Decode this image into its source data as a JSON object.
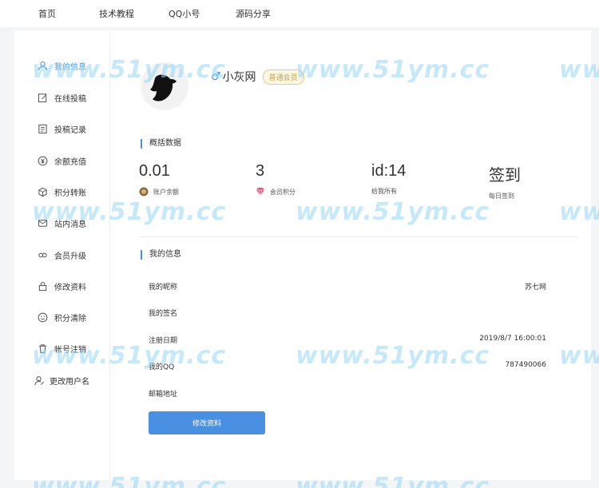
{
  "topnav": {
    "items": [
      "首页",
      "技术教程",
      "QQ小号",
      "源码分享"
    ]
  },
  "sidebar": {
    "items": [
      {
        "label": "我的信息",
        "icon": "user-icon",
        "active": true
      },
      {
        "label": "在线投稿",
        "icon": "edit-icon"
      },
      {
        "label": "投稿记录",
        "icon": "document-icon"
      },
      {
        "label": "余额充值",
        "icon": "yen-icon"
      },
      {
        "label": "积分转账",
        "icon": "cube-icon"
      },
      {
        "label": "站内消息",
        "icon": "message-icon"
      },
      {
        "label": "会员升级",
        "icon": "vip-icon"
      },
      {
        "label": "修改资料",
        "icon": "lock-icon"
      },
      {
        "label": "积分清除",
        "icon": "smile-icon"
      },
      {
        "label": "帐号注销",
        "icon": "trash-icon"
      },
      {
        "label": "更改用户名",
        "icon": "user-edit-icon"
      }
    ]
  },
  "profile": {
    "gender_symbol": "♂",
    "username": "小灰网",
    "level_badge": "普通会员"
  },
  "overview": {
    "title": "概括数据",
    "stats": [
      {
        "value": "0.01",
        "label": "账户余额",
        "icon": "coin-icon"
      },
      {
        "value": "3",
        "label": "会员积分",
        "icon": "diamond-icon"
      },
      {
        "value": "id:14",
        "label": "给我所有",
        "icon": ""
      },
      {
        "value": "签到",
        "label": "每日签到",
        "icon": ""
      }
    ]
  },
  "myinfo": {
    "title": "我的信息",
    "rows": [
      {
        "key": "我的昵称",
        "value": "苏七网"
      },
      {
        "key": "我的签名",
        "value": ""
      },
      {
        "key": "注册日期",
        "value": "2019/8/7 16:00:01"
      },
      {
        "key": "我的QQ",
        "value": "787490066"
      },
      {
        "key": "邮箱地址",
        "value": ""
      }
    ],
    "button_label": "修改资料"
  },
  "watermark": {
    "text": "www.51ym.cc"
  },
  "colors": {
    "accent": "#4a90e2",
    "badge": "#c8a040",
    "watermark": "#96d7f5"
  }
}
